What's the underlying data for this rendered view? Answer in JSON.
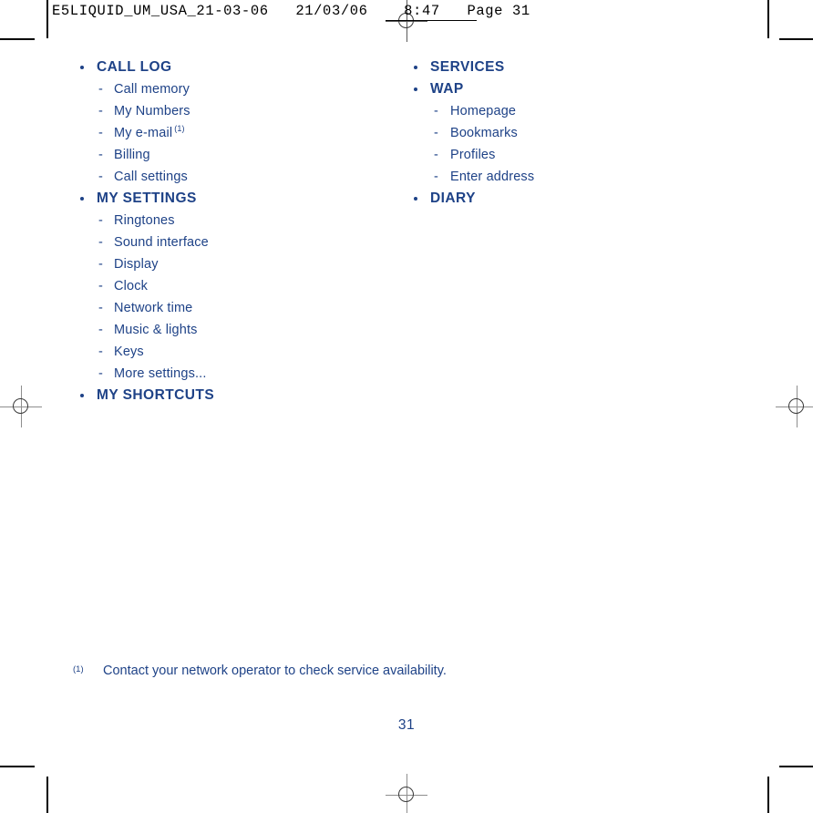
{
  "header": {
    "slug": "E5LIQUID_UM_USA_21-03-06   21/03/06    8:47   Page 31"
  },
  "columns": {
    "left": [
      {
        "label": "CALL LOG",
        "items": [
          {
            "label": "Call memory",
            "footnote": ""
          },
          {
            "label": "My Numbers",
            "footnote": ""
          },
          {
            "label": "My e-mail",
            "footnote": "(1)"
          },
          {
            "label": "Billing",
            "footnote": ""
          },
          {
            "label": "Call settings",
            "footnote": ""
          }
        ]
      },
      {
        "label": "MY SETTINGS",
        "items": [
          {
            "label": "Ringtones",
            "footnote": ""
          },
          {
            "label": "Sound interface",
            "footnote": ""
          },
          {
            "label": "Display",
            "footnote": ""
          },
          {
            "label": "Clock",
            "footnote": ""
          },
          {
            "label": "Network time",
            "footnote": ""
          },
          {
            "label": "Music & lights",
            "footnote": ""
          },
          {
            "label": "Keys",
            "footnote": ""
          },
          {
            "label": "More settings...",
            "footnote": ""
          }
        ]
      },
      {
        "label": "MY SHORTCUTS",
        "items": []
      }
    ],
    "right": [
      {
        "label": "SERVICES",
        "items": []
      },
      {
        "label": "WAP",
        "items": [
          {
            "label": "Homepage",
            "footnote": ""
          },
          {
            "label": "Bookmarks",
            "footnote": ""
          },
          {
            "label": "Profiles",
            "footnote": ""
          },
          {
            "label": "Enter address",
            "footnote": ""
          }
        ]
      },
      {
        "label": "DIARY",
        "items": []
      }
    ]
  },
  "footnote": {
    "marker": "(1)",
    "text": "Contact your network operator to check service availability."
  },
  "folio": {
    "page_number": "31"
  },
  "colors": {
    "text_blue": "#1e4287",
    "crop_mark": "#000000",
    "registration": "#8e8e8e",
    "page_background": "#ffffff"
  },
  "print_marks": {
    "dash": "-",
    "bullet": "•"
  }
}
